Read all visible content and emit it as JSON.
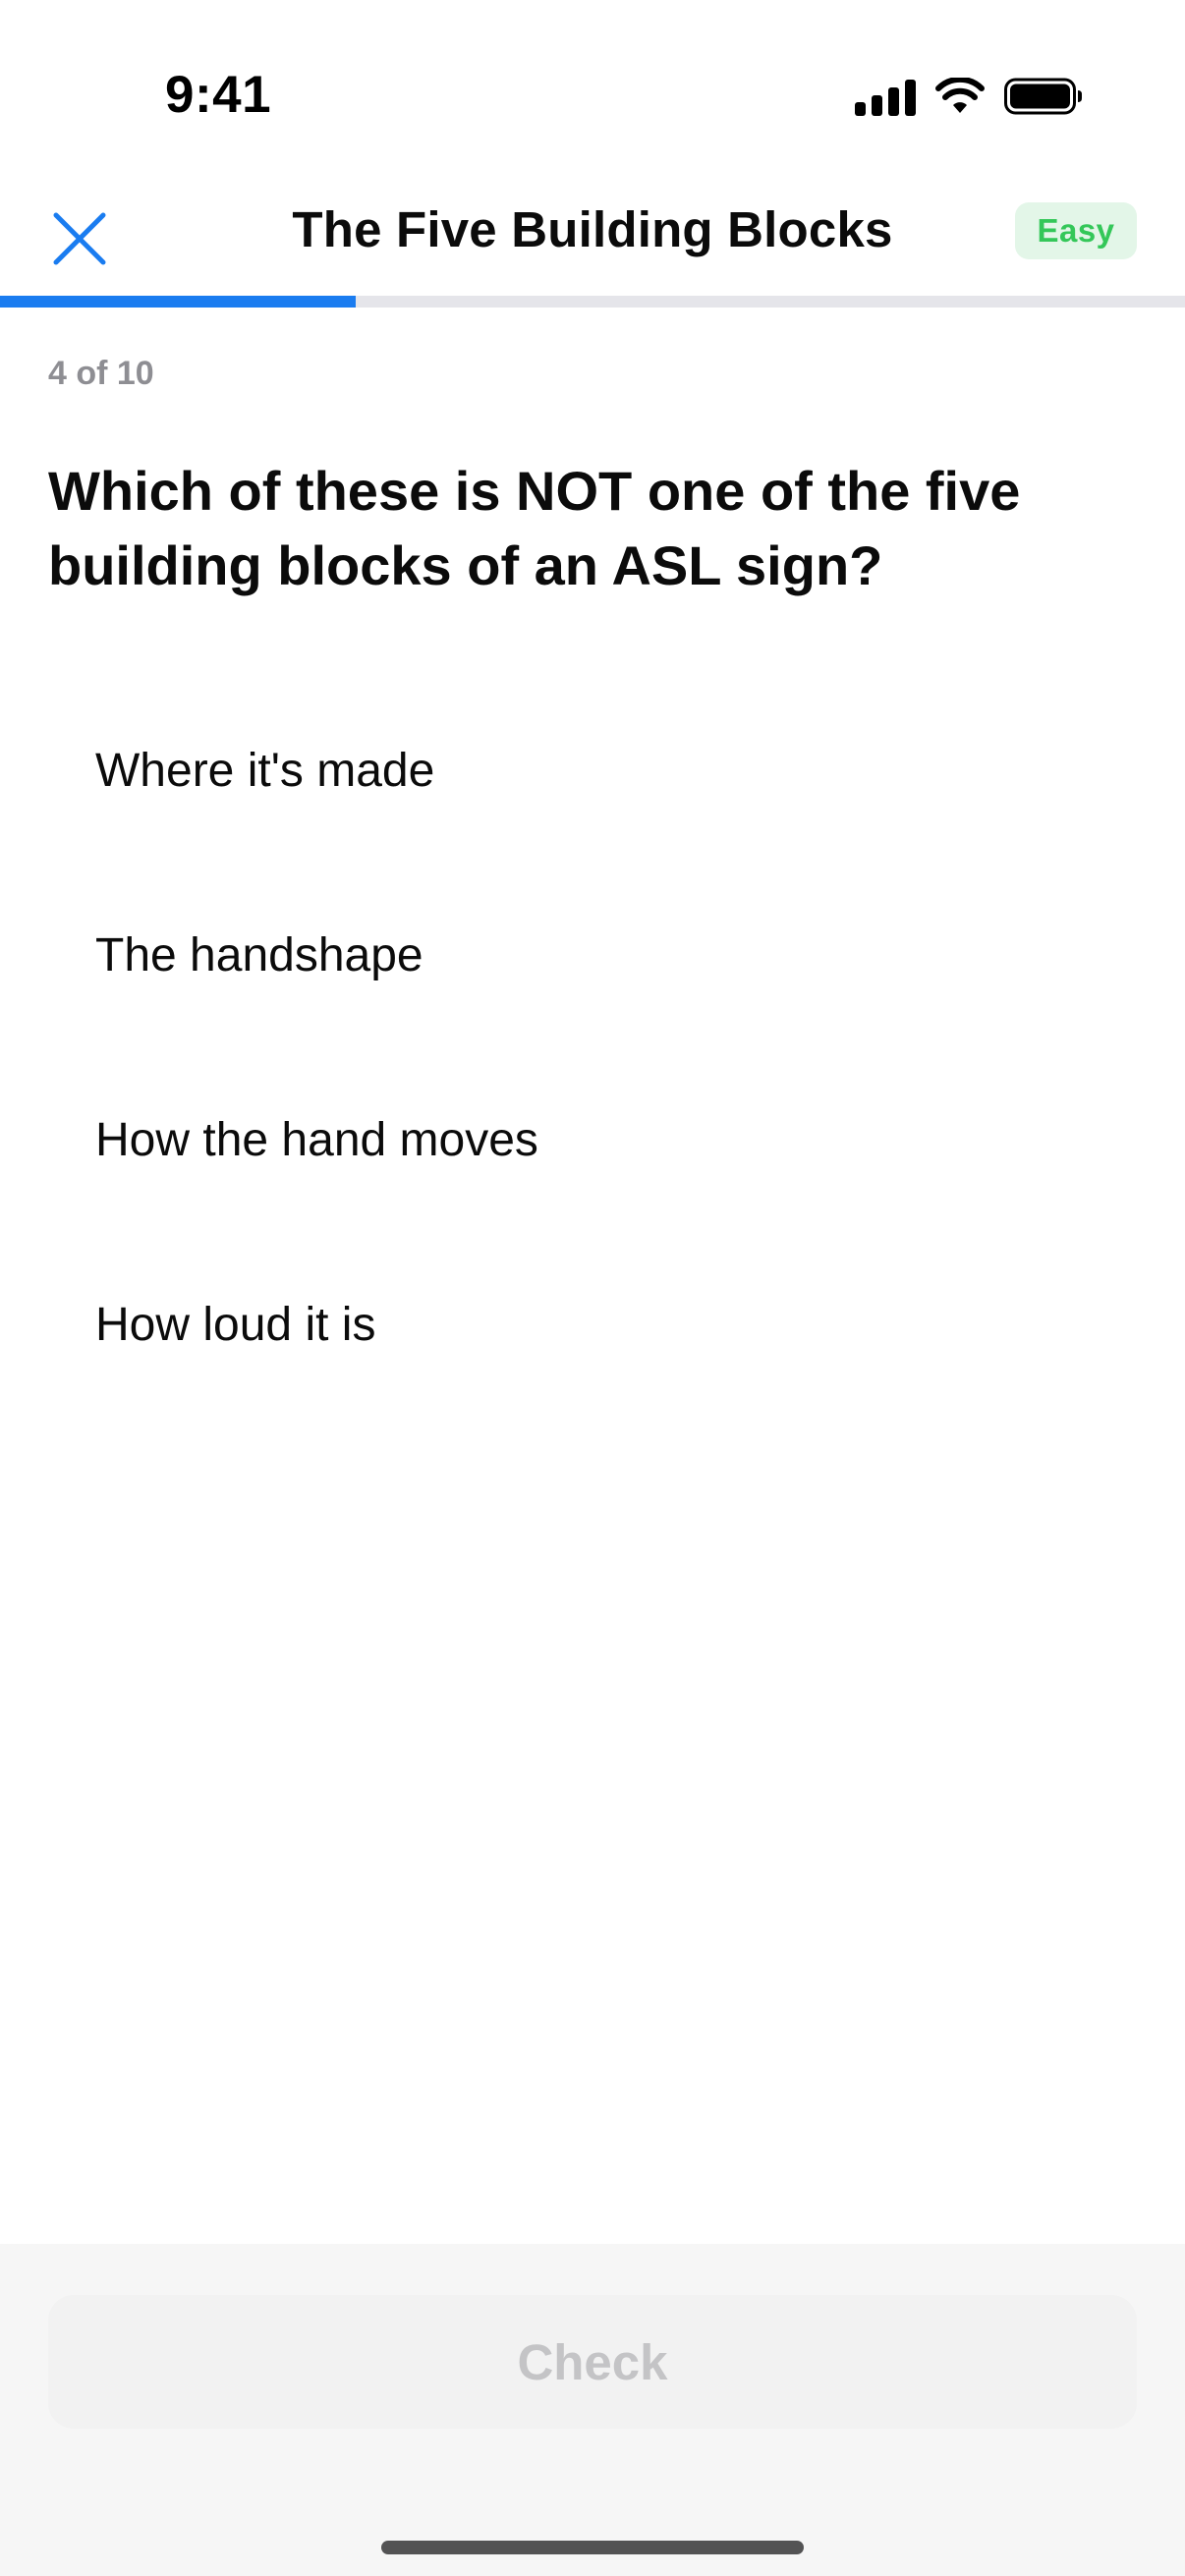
{
  "status_bar": {
    "time": "9:41",
    "icons": [
      "cellular-signal-icon",
      "wifi-icon",
      "battery-icon"
    ]
  },
  "header": {
    "close_icon": "close-icon",
    "title": "The Five Building Blocks",
    "difficulty": "Easy"
  },
  "progress": {
    "fraction": 0.3
  },
  "question": {
    "counter": "4 of 10",
    "text": "Which of these is NOT one of the five building blocks of an ASL sign?",
    "options": [
      {
        "label": "Where it's made"
      },
      {
        "label": "The handshape"
      },
      {
        "label": "How the hand moves"
      },
      {
        "label": "How loud it is"
      }
    ]
  },
  "footer": {
    "check_label": "Check"
  },
  "colors": {
    "accent": "#1a7cf0",
    "badge_text": "#34c759",
    "badge_bg": "#e3f6e8",
    "disabled_text": "#c4c4c6"
  }
}
